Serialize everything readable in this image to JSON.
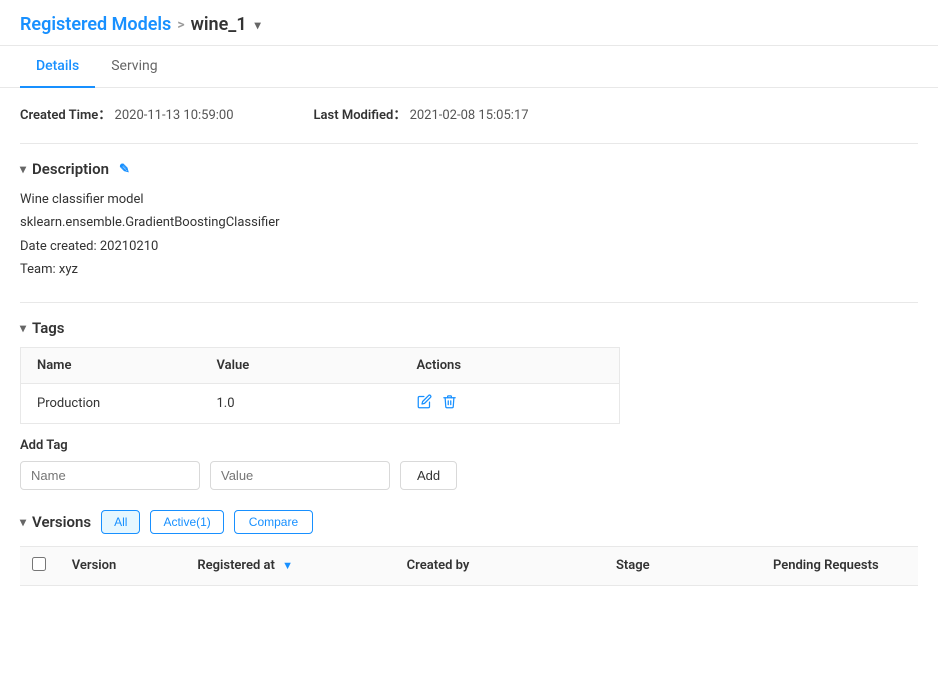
{
  "breadcrumb": {
    "parent_label": "Registered Models",
    "separator": ">",
    "current": "wine_1",
    "dropdown_icon": "▾"
  },
  "tabs": [
    {
      "id": "details",
      "label": "Details",
      "active": true
    },
    {
      "id": "serving",
      "label": "Serving",
      "active": false
    }
  ],
  "meta": {
    "created_label": "Created Time：",
    "created_value": "2020-11-13 10:59:00",
    "modified_label": "Last Modified：",
    "modified_value": "2021-02-08 15:05:17"
  },
  "description": {
    "toggle": "▾",
    "title": "Description",
    "edit_icon": "✎",
    "lines": [
      "Wine classifier model",
      "sklearn.ensemble.GradientBoostingClassifier",
      "Date created: 20210210",
      "Team: xyz"
    ]
  },
  "tags": {
    "toggle": "▾",
    "title": "Tags",
    "columns": [
      "Name",
      "Value",
      "Actions"
    ],
    "rows": [
      {
        "name": "Production",
        "value": "1.0"
      }
    ],
    "add_label": "Add Tag",
    "name_placeholder": "Name",
    "value_placeholder": "Value",
    "add_button": "Add"
  },
  "versions": {
    "toggle": "▾",
    "title": "Versions",
    "filters": [
      {
        "id": "all",
        "label": "All",
        "active": true
      },
      {
        "id": "active",
        "label": "Active(1)",
        "active": false
      }
    ],
    "compare_button": "Compare",
    "columns": [
      {
        "id": "checkbox",
        "label": ""
      },
      {
        "id": "version",
        "label": "Version"
      },
      {
        "id": "registered_at",
        "label": "Registered at",
        "sortable": true
      },
      {
        "id": "created_by",
        "label": "Created by"
      },
      {
        "id": "stage",
        "label": "Stage"
      },
      {
        "id": "pending_requests",
        "label": "Pending Requests"
      }
    ]
  },
  "icons": {
    "edit": "✎",
    "delete": "🗑",
    "pencil": "✏",
    "sort_asc": "▼",
    "chevron_down": "▾",
    "section_toggle": "▾"
  }
}
